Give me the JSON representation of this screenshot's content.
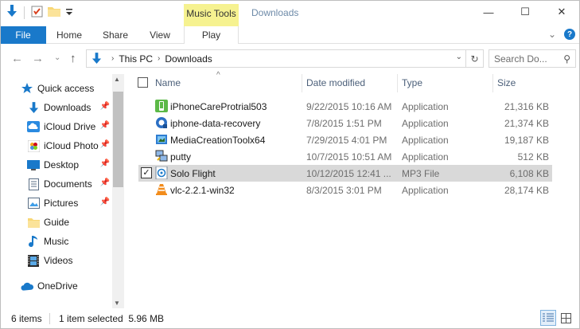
{
  "window": {
    "title": "Downloads",
    "context_group": "Music Tools",
    "minimize_glyph": "—",
    "maximize_glyph": "☐",
    "close_glyph": "✕"
  },
  "ribbon": {
    "tabs": [
      {
        "label": "File"
      },
      {
        "label": "Home"
      },
      {
        "label": "Share"
      },
      {
        "label": "View"
      },
      {
        "label": "Play"
      }
    ],
    "expand_glyph": "⌄",
    "help_glyph": "?"
  },
  "address": {
    "crumbs": [
      "This PC",
      "Downloads"
    ],
    "search_placeholder": "Search Do...",
    "back_glyph": "←",
    "forward_glyph": "→",
    "recent_glyph": "⌄",
    "up_glyph": "↑",
    "separator_glyph": "›",
    "dropdown_glyph": "⌄",
    "refresh_glyph": "↻",
    "search_glyph": "⚲"
  },
  "nav": {
    "items": [
      {
        "label": "Quick access",
        "icon": "star-icon"
      },
      {
        "label": "Downloads",
        "icon": "download-arrow-icon",
        "pinned": true
      },
      {
        "label": "iCloud Drive",
        "icon": "cloud-icon",
        "pinned": true
      },
      {
        "label": "iCloud Photo",
        "icon": "photos-icon",
        "pinned": true
      },
      {
        "label": "Desktop",
        "icon": "desktop-icon",
        "pinned": true
      },
      {
        "label": "Documents",
        "icon": "documents-icon",
        "pinned": true
      },
      {
        "label": "Pictures",
        "icon": "pictures-icon",
        "pinned": true
      },
      {
        "label": "Guide",
        "icon": "folder-icon"
      },
      {
        "label": "Music",
        "icon": "music-note-icon"
      },
      {
        "label": "Videos",
        "icon": "film-icon"
      },
      {
        "label": "OneDrive",
        "icon": "onedrive-cloud-icon"
      }
    ],
    "pin_glyph": "📌"
  },
  "columns": {
    "name": "Name",
    "date": "Date modified",
    "type": "Type",
    "size": "Size",
    "sort_glyph": "^"
  },
  "files": [
    {
      "name": "iPhoneCareProtrial503",
      "date": "9/22/2015 10:16 AM",
      "type": "Application",
      "size": "21,316 KB",
      "icon": "green-app-icon"
    },
    {
      "name": "iphone-data-recovery",
      "date": "7/8/2015 1:51 PM",
      "type": "Application",
      "size": "21,374 KB",
      "icon": "blue-app-icon"
    },
    {
      "name": "MediaCreationToolx64",
      "date": "7/29/2015 4:01 PM",
      "type": "Application",
      "size": "19,187 KB",
      "icon": "media-tool-icon"
    },
    {
      "name": "putty",
      "date": "10/7/2015 10:51 AM",
      "type": "Application",
      "size": "512 KB",
      "icon": "putty-icon"
    },
    {
      "name": "Solo Flight",
      "date": "10/12/2015 12:41 ...",
      "type": "MP3 File",
      "size": "6,108 KB",
      "icon": "mp3-icon",
      "selected": true
    },
    {
      "name": "vlc-2.2.1-win32",
      "date": "8/3/2015 3:01 PM",
      "type": "Application",
      "size": "28,174 KB",
      "icon": "vlc-cone-icon"
    }
  ],
  "selection_check_glyph": "✓",
  "status": {
    "count": "6 items",
    "selected": "1 item selected  5.96 MB"
  },
  "colors": {
    "accent": "#1979ca",
    "context_yellow": "#f6f290",
    "selection": "#d9d9d9"
  }
}
